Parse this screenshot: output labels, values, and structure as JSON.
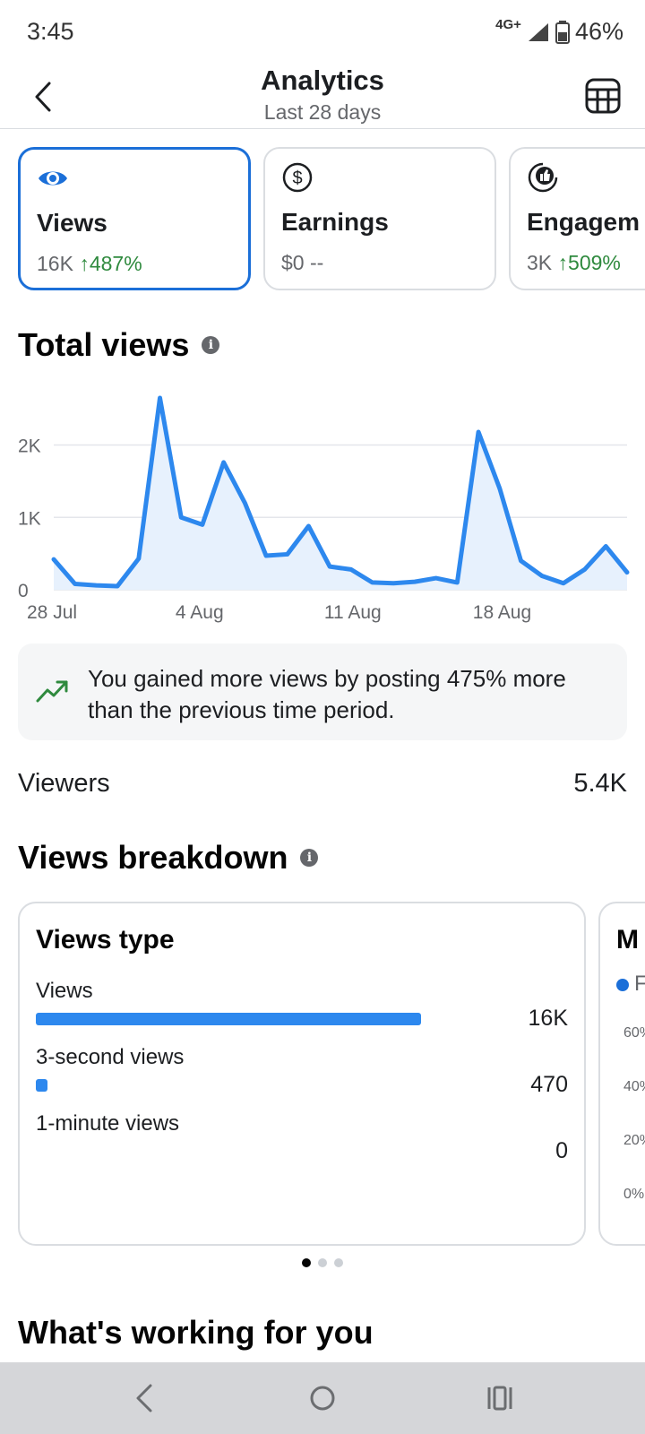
{
  "status_bar": {
    "time": "3:45",
    "network": "4G+",
    "battery": "46%"
  },
  "header": {
    "title": "Analytics",
    "subtitle": "Last 28 days"
  },
  "metrics": [
    {
      "label": "Views",
      "value": "16K",
      "change": "↑487%",
      "icon": "eye-icon",
      "active": true
    },
    {
      "label": "Earnings",
      "value": "$0 --",
      "change": "",
      "icon": "dollar-icon",
      "active": false
    },
    {
      "label": "Engagem",
      "value": "3K",
      "change": "↑509%",
      "icon": "thumbs-up-icon",
      "active": false
    }
  ],
  "total_views": {
    "title": "Total views"
  },
  "chart_data": {
    "type": "area",
    "title": "",
    "xlabel": "",
    "ylabel": "",
    "x_tick_labels": [
      "28 Jul",
      "4 Aug",
      "11 Aug",
      "18 Aug"
    ],
    "y_tick_labels": [
      "0",
      "1K",
      "2K"
    ],
    "ylim": [
      0,
      2700
    ],
    "grid": true,
    "color": "#2d88ee",
    "x": [
      "28 Jul",
      "29 Jul",
      "30 Jul",
      "31 Jul",
      "1 Aug",
      "2 Aug",
      "3 Aug",
      "4 Aug",
      "5 Aug",
      "6 Aug",
      "7 Aug",
      "8 Aug",
      "9 Aug",
      "10 Aug",
      "11 Aug",
      "12 Aug",
      "13 Aug",
      "14 Aug",
      "15 Aug",
      "16 Aug",
      "17 Aug",
      "18 Aug",
      "19 Aug",
      "20 Aug",
      "21 Aug",
      "22 Aug",
      "23 Aug",
      "24 Aug"
    ],
    "values": [
      420,
      80,
      60,
      50,
      430,
      2650,
      1000,
      900,
      1760,
      1200,
      470,
      490,
      880,
      320,
      280,
      100,
      90,
      110,
      160,
      100,
      2180,
      1400,
      400,
      190,
      90,
      280,
      600,
      240
    ]
  },
  "insight": {
    "icon": "trending-up-icon",
    "text": "You gained more views by posting 475% more than the previous time period."
  },
  "viewers": {
    "label": "Viewers",
    "value": "5.4K"
  },
  "views_breakdown": {
    "title": "Views breakdown",
    "card_title": "Views type",
    "items": [
      {
        "label": "Views",
        "value": "16K",
        "fraction": 1.0
      },
      {
        "label": "3-second views",
        "value": "470",
        "fraction": 0.03
      },
      {
        "label": "1-minute views",
        "value": "0",
        "fraction": 0
      }
    ],
    "next_card": {
      "title_partial": "M",
      "legend_partial": "F",
      "ticks": [
        "60%",
        "40%",
        "20%",
        "0%"
      ]
    },
    "pager": {
      "count": 3,
      "active": 0
    }
  },
  "whats_working": {
    "title": "What's working for you"
  }
}
